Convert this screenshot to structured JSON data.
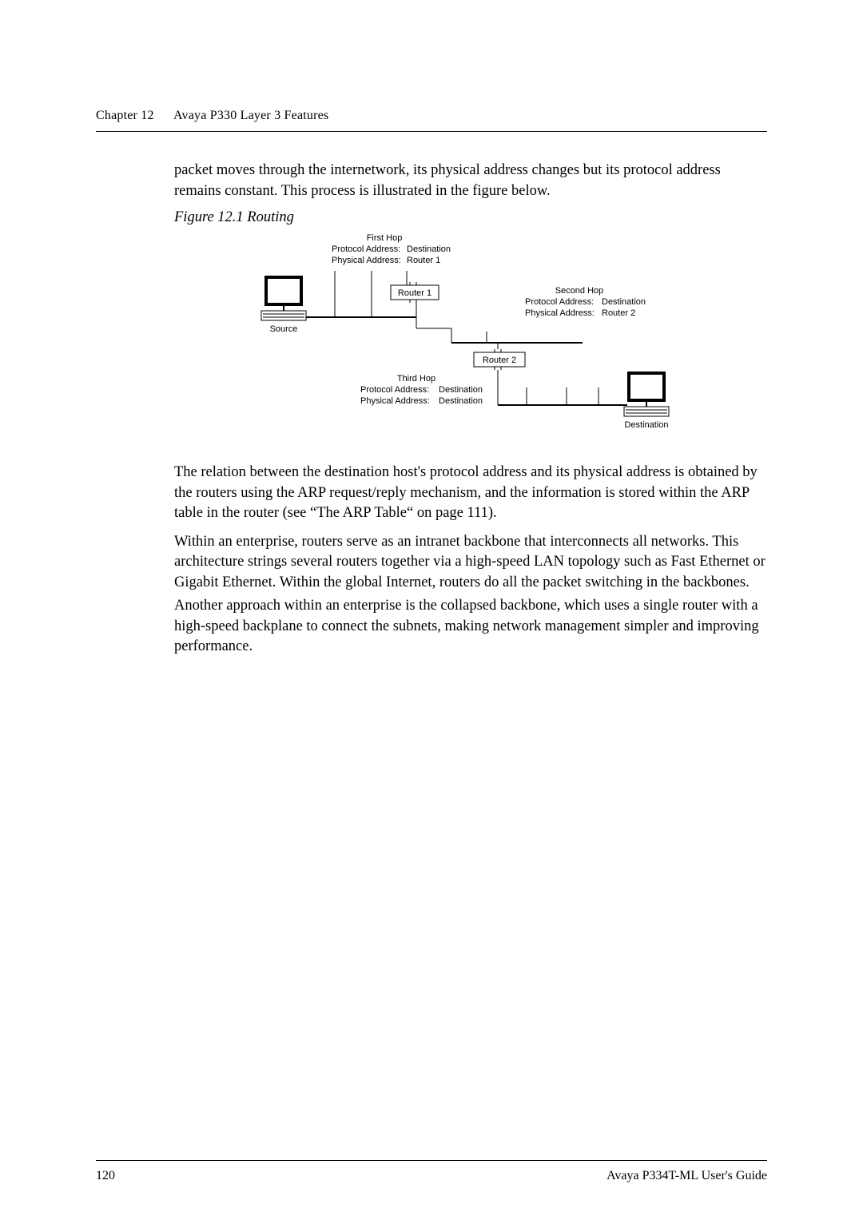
{
  "header": {
    "chapter": "Chapter 12",
    "title": "Avaya P330 Layer 3 Features"
  },
  "intro": "packet moves through the internetwork, its physical address changes but its protocol address remains constant. This process is illustrated in the figure below.",
  "figure": {
    "caption": "Figure 12.1    Routing",
    "labels": {
      "first_hop_title": "First Hop",
      "first_pa": "Protocol Address:",
      "first_pa_val": "Destination",
      "first_ph": "Physical Address:",
      "first_ph_val": "Router 1",
      "second_hop_title": "Second Hop",
      "second_pa": "Protocol Address:",
      "second_pa_val": "Destination",
      "second_ph": "Physical Address:",
      "second_ph_val": "Router 2",
      "third_hop_title": "Third Hop",
      "third_pa": "Protocol Address:",
      "third_pa_val": "Destination",
      "third_ph": "Physical Address:",
      "third_ph_val": "Destination",
      "source": "Source",
      "destination": "Destination",
      "router1": "Router 1",
      "router2": "Router 2"
    }
  },
  "body": {
    "p1": "The relation between the destination host's protocol address and its physical address is obtained by the routers using the ARP request/reply mechanism, and the information is stored within the ARP table in the router (see “The ARP Table“ on page 111).",
    "p2": "Within an enterprise, routers serve as an intranet backbone that interconnects all networks. This architecture strings several routers together via a high-speed LAN topology such as Fast Ethernet or Gigabit Ethernet. Within the global Internet, routers do all the packet switching in the backbones.",
    "p3": "Another approach within an enterprise is the collapsed backbone, which uses a single router with a high-speed backplane to connect the subnets, making network management simpler and improving performance."
  },
  "footer": {
    "page": "120",
    "doc": "Avaya P334T-ML User's Guide"
  }
}
